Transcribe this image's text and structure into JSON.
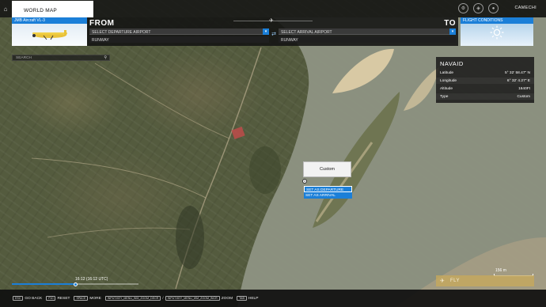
{
  "topbar": {
    "home_icon": "home-icon",
    "tab_label": "WORLD MAP",
    "username": "CAMECHI",
    "icons": [
      "settings-icon",
      "marketplace-icon",
      "profile-icon"
    ]
  },
  "aircraft": {
    "name": "JMB Aircraft VL-3"
  },
  "flight": {
    "from_label": "FROM",
    "to_label": "TO",
    "departure_placeholder": "SELECT DEPARTURE AIRPORT",
    "arrival_placeholder": "SELECT ARRIVAL AIRPORT",
    "runway_from": "RUNWAY",
    "runway_to": "RUNWAY",
    "swap_icon": "swap-icon"
  },
  "conditions": {
    "title": "FLIGHT CONDITIONS",
    "weather_icon": "sun-icon"
  },
  "search": {
    "placeholder": "SEARCH"
  },
  "navaid": {
    "title": "NAVAID",
    "rows": [
      {
        "label": "Latitude",
        "value": "5° 32' 58.47\" N"
      },
      {
        "label": "Longitude",
        "value": "6° 32' 4.27\" E"
      },
      {
        "label": "Altitude",
        "value": "1640Ft"
      },
      {
        "label": "Type",
        "value": "Custom"
      }
    ]
  },
  "marker": {
    "card_label": "Custom",
    "pin_label": "1",
    "menu": [
      "SET AS DEPARTURE",
      "SET AS ARRIVAL"
    ]
  },
  "time": {
    "label": "16:12 (16:12 UTC)",
    "progress": 0.5
  },
  "scale": {
    "label": "156 m"
  },
  "fly": {
    "label": "FLY"
  },
  "bottom_hints": [
    {
      "key": "ESC",
      "label": "GO BACK"
    },
    {
      "key": "F10",
      "label": "RESET"
    },
    {
      "key": "SPACE",
      "label": "MORE"
    },
    {
      "key": "INPUT.KEY_MENU_WM_ZOOM_DECR",
      "label": "/"
    },
    {
      "key": "INPUT.KEY_MENU_WM_ZOOM_INCR",
      "label": "ZOOM"
    },
    {
      "key": "TAB",
      "label": "HELP"
    }
  ],
  "colors": {
    "accent": "#1b7fd8",
    "river": "#8c8f80",
    "sand": "#d9c9a6",
    "land": "#545b3e"
  }
}
